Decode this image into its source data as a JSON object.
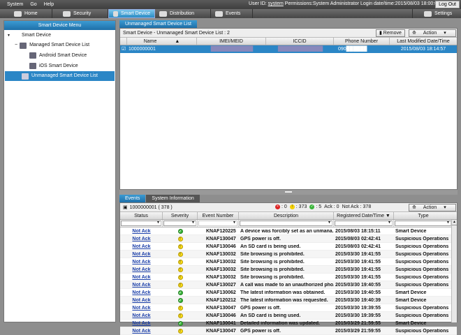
{
  "menubar": {
    "items": [
      "System",
      "Go",
      "Help"
    ],
    "user_label": "User ID:",
    "user_id": "system",
    "permissions": "Permissions:System Administrator",
    "login": "Login date/time:2015/08/03 18:00:07",
    "logout": "Log Out"
  },
  "navbar": {
    "home": "Home",
    "security": "Security",
    "smart_device": "Smart Device",
    "distribution": "Distribution",
    "events": "Events",
    "settings": "Settings"
  },
  "left_panel": {
    "title": "Smart Device Menu",
    "tree": [
      "Smart Device",
      "Managed Smart Device List",
      "Android Smart Device",
      "iOS Smart Device",
      "Unmanaged Smart Device List"
    ]
  },
  "upper": {
    "tab": "Unmanaged Smart Device List",
    "caption": "Smart Device - Unmanaged Smart Device List : 2",
    "remove": "Remove",
    "action": "Action",
    "columns": [
      "Name",
      "IMEI/MEID",
      "ICCID",
      "Phone Number",
      "Last Modified Date/Time"
    ],
    "rows": [
      {
        "name": "1000000001",
        "imei": "███████████████",
        "iccid": "████████████████",
        "phone": "090██████",
        "date": "2015/08/03 18:14:57"
      }
    ]
  },
  "lower": {
    "tabs": [
      "Events",
      "System Information"
    ],
    "device": "1000000001 ( 378 )",
    "counts": {
      "error": ": 0",
      "warning": ": 373",
      "ok": ": 5",
      "ack": "Ack : 0",
      "notack": "Not Ack : 378"
    },
    "action": "Action",
    "columns": [
      "Status",
      "Severity",
      "Event Number",
      "Description",
      "Registered Date/Time ▼",
      "Type"
    ],
    "rows": [
      {
        "status": "Not Ack",
        "sev": "ok",
        "num": "KNAF120225",
        "desc": "A device was forcibly set as an unmana...",
        "date": "2015/08/03 18:15:11",
        "type": "Smart Device"
      },
      {
        "status": "Not Ack",
        "sev": "warn",
        "num": "KNAF130047",
        "desc": "GPS power is off.",
        "date": "2015/08/03 02:42:41",
        "type": "Suspicious Operations"
      },
      {
        "status": "Not Ack",
        "sev": "warn",
        "num": "KNAF130046",
        "desc": "An SD card is being used.",
        "date": "2015/08/03 02:42:41",
        "type": "Suspicious Operations"
      },
      {
        "status": "Not Ack",
        "sev": "warn",
        "num": "KNAF130032",
        "desc": "Site browsing is prohibited.",
        "date": "2015/03/30 19:41:55",
        "type": "Suspicious Operations"
      },
      {
        "status": "Not Ack",
        "sev": "warn",
        "num": "KNAF130032",
        "desc": "Site browsing is prohibited.",
        "date": "2015/03/30 19:41:55",
        "type": "Suspicious Operations"
      },
      {
        "status": "Not Ack",
        "sev": "warn",
        "num": "KNAF130032",
        "desc": "Site browsing is prohibited.",
        "date": "2015/03/30 19:41:55",
        "type": "Suspicious Operations"
      },
      {
        "status": "Not Ack",
        "sev": "warn",
        "num": "KNAF130032",
        "desc": "Site browsing is prohibited.",
        "date": "2015/03/30 19:41:55",
        "type": "Suspicious Operations"
      },
      {
        "status": "Not Ack",
        "sev": "warn",
        "num": "KNAF130027",
        "desc": "A call was made to an unauthorized pho...",
        "date": "2015/03/30 19:40:55",
        "type": "Suspicious Operations"
      },
      {
        "status": "Not Ack",
        "sev": "ok",
        "num": "KNAF130062",
        "desc": "The latest information was obtained.",
        "date": "2015/03/30 19:40:55",
        "type": "Smart Device"
      },
      {
        "status": "Not Ack",
        "sev": "ok",
        "num": "KNAF120212",
        "desc": "The latest information was requested.",
        "date": "2015/03/30 19:40:39",
        "type": "Smart Device"
      },
      {
        "status": "Not Ack",
        "sev": "warn",
        "num": "KNAF130047",
        "desc": "GPS power is off.",
        "date": "2015/03/30 19:39:55",
        "type": "Suspicious Operations"
      },
      {
        "status": "Not Ack",
        "sev": "warn",
        "num": "KNAF130046",
        "desc": "An SD card is being used.",
        "date": "2015/03/30 19:39:55",
        "type": "Suspicious Operations"
      },
      {
        "status": "Not Ack",
        "sev": "ok",
        "num": "KNAF130041",
        "desc": "Detailed information was updated.",
        "date": "2015/03/29 21:59:55",
        "type": "Smart Device"
      },
      {
        "status": "Not Ack",
        "sev": "warn",
        "num": "KNAF130047",
        "desc": "GPS power is off.",
        "date": "2015/03/29 21:59:55",
        "type": "Suspicious Operations"
      }
    ]
  }
}
